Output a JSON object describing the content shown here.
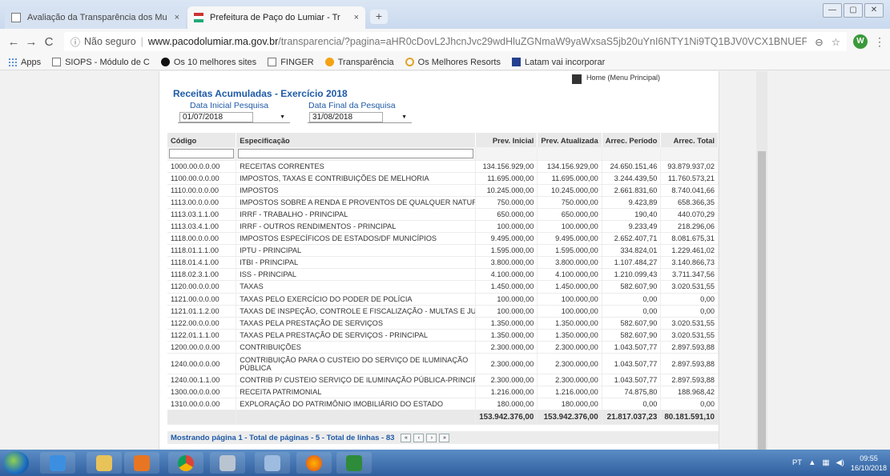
{
  "browser": {
    "tabs": [
      {
        "title": "Avaliação da Transparência dos Mu",
        "active": false,
        "close": "×"
      },
      {
        "title": "Prefeitura de Paço do Lumiar - Tr",
        "active": true,
        "close": "×"
      }
    ],
    "new_tab": "+",
    "window_buttons": [
      "—",
      "▢",
      "✕"
    ],
    "nav": {
      "back": "←",
      "forward": "→",
      "reload": "C"
    },
    "secure_icon": "ⓘ",
    "secure_label": "Não seguro",
    "separator": "|",
    "url_host": "www.pacodolumiar.ma.gov.br",
    "url_path": "/transparencia/?pagina=aHR0cDovL2JhcnJvc29wdHluZGNmaW9yaWxsaS5jb20uYnI6NTY1Ni9TQ1BJV0VCX1BNUEFDT0RPTFVNS...",
    "zoom_icon": "⊖",
    "star_icon": "☆",
    "profile_initial": "W",
    "menu_icon": "⋮",
    "bookmarks": [
      {
        "label": "Apps",
        "icon": "apps-grid-icon"
      },
      {
        "label": "SIOPS - Módulo de C",
        "icon": "page-icon"
      },
      {
        "label": "Os 10 melhores sites",
        "icon": "black-circle-icon"
      },
      {
        "label": "FINGER",
        "icon": "page-icon"
      },
      {
        "label": "Transparência",
        "icon": "info-orange-icon"
      },
      {
        "label": "Os Melhores Resorts",
        "icon": "ring-icon"
      },
      {
        "label": "Latam vai incorporar",
        "icon": "latam-icon"
      }
    ]
  },
  "page": {
    "home_link": "Home (Menu Principal)",
    "title": "Receitas Acumuladas - Exercício 2018",
    "data_inicial_label": "Data Inicial Pesquisa",
    "data_final_label": "Data Final da Pesquisa",
    "data_inicial": "01/07/2018",
    "data_final": "31/08/2018",
    "columns": [
      "Código",
      "Especificação",
      "Prev. Inicial",
      "Prev. Atualizada",
      "Arrec. Período",
      "Arrec. Total"
    ],
    "rows": [
      [
        "1000.00.0.0.00",
        "RECEITAS CORRENTES",
        "134.156.929,00",
        "134.156.929,00",
        "24.650.151,46",
        "93.879.937,02"
      ],
      [
        "1100.00.0.0.00",
        "IMPOSTOS, TAXAS E CONTRIBUIÇÕES DE MELHORIA",
        "11.695.000,00",
        "11.695.000,00",
        "3.244.439,50",
        "11.760.573,21"
      ],
      [
        "1110.00.0.0.00",
        "IMPOSTOS",
        "10.245.000,00",
        "10.245.000,00",
        "2.661.831,60",
        "8.740.041,66"
      ],
      [
        "1113.00.0.0.00",
        "IMPOSTOS SOBRE A RENDA E PROVENTOS DE QUALQUER NATUREZA",
        "750.000,00",
        "750.000,00",
        "9.423,89",
        "658.366,35"
      ],
      [
        "1113.03.1.1.00",
        "IRRF - TRABALHO - PRINCIPAL",
        "650.000,00",
        "650.000,00",
        "190,40",
        "440.070,29"
      ],
      [
        "1113.03.4.1.00",
        "IRRF - OUTROS RENDIMENTOS - PRINCIPAL",
        "100.000,00",
        "100.000,00",
        "9.233,49",
        "218.296,06"
      ],
      [
        "1118.00.0.0.00",
        "IMPOSTOS ESPECÍFICOS DE ESTADOS/DF MUNICÍPIOS",
        "9.495.000,00",
        "9.495.000,00",
        "2.652.407,71",
        "8.081.675,31"
      ],
      [
        "1118.01.1.1.00",
        "IPTU - PRINCIPAL",
        "1.595.000,00",
        "1.595.000,00",
        "334.824,01",
        "1.229.461,02"
      ],
      [
        "1118.01.4.1.00",
        "ITBI - PRINCIPAL",
        "3.800.000,00",
        "3.800.000,00",
        "1.107.484,27",
        "3.140.866,73"
      ],
      [
        "1118.02.3.1.00",
        "ISS - PRINCIPAL",
        "4.100.000,00",
        "4.100.000,00",
        "1.210.099,43",
        "3.711.347,56"
      ],
      [
        "1120.00.0.0.00",
        "TAXAS",
        "1.450.000,00",
        "1.450.000,00",
        "582.607,90",
        "3.020.531,55"
      ],
      [
        "1121.00.0.0.00",
        "TAXAS PELO EXERCÍCIO DO PODER DE POLÍCIA",
        "100.000,00",
        "100.000,00",
        "0,00",
        "0,00"
      ],
      [
        "1121.01.1.2.00",
        "TAXAS DE INSPEÇÃO, CONTROLE E FISCALIZAÇÃO - MULTAS E JUROS",
        "100.000,00",
        "100.000,00",
        "0,00",
        "0,00"
      ],
      [
        "1122.00.0.0.00",
        "TAXAS PELA PRESTAÇÃO DE SERVIÇOS",
        "1.350.000,00",
        "1.350.000,00",
        "582.607,90",
        "3.020.531,55"
      ],
      [
        "1122.01.1.1.00",
        "TAXAS PELA PRESTAÇÃO DE SERVIÇOS - PRINCIPAL",
        "1.350.000,00",
        "1.350.000,00",
        "582.607,90",
        "3.020.531,55"
      ],
      [
        "1200.00.0.0.00",
        "CONTRIBUIÇÕES",
        "2.300.000,00",
        "2.300.000,00",
        "1.043.507,77",
        "2.897.593,88"
      ],
      [
        "1240.00.0.0.00",
        "CONTRIBUIÇÃO PARA O CUSTEIO DO SERVIÇO DE ILUMINAÇÃO PÚBLICA",
        "2.300.000,00",
        "2.300.000,00",
        "1.043.507,77",
        "2.897.593,88"
      ],
      [
        "1240.00.1.1.00",
        "CONTRIB P/ CUSTEIO SERVIÇO DE ILUMINAÇÃO PÚBLICA-PRINCIPAL",
        "2.300.000,00",
        "2.300.000,00",
        "1.043.507,77",
        "2.897.593,88"
      ],
      [
        "1300.00.0.0.00",
        "RECEITA PATRIMONIAL",
        "1.216.000,00",
        "1.216.000,00",
        "74.875,80",
        "188.968,42"
      ],
      [
        "1310.00.0.0.00",
        "EXPLORAÇÃO DO PATRIMÔNIO IMOBILIÁRIO DO ESTADO",
        "180.000,00",
        "180.000,00",
        "0,00",
        "0,00"
      ]
    ],
    "totals": [
      "153.942.376,00",
      "153.942.376,00",
      "21.817.037,23",
      "80.181.591,10"
    ],
    "footer": "Mostrando página 1 - Total de páginas - 5 - Total de linhas - 83",
    "pager": [
      "«",
      "‹",
      "›",
      "»"
    ]
  },
  "taskbar": {
    "language": "PT",
    "time": "09:55",
    "date": "16/10/2018"
  }
}
